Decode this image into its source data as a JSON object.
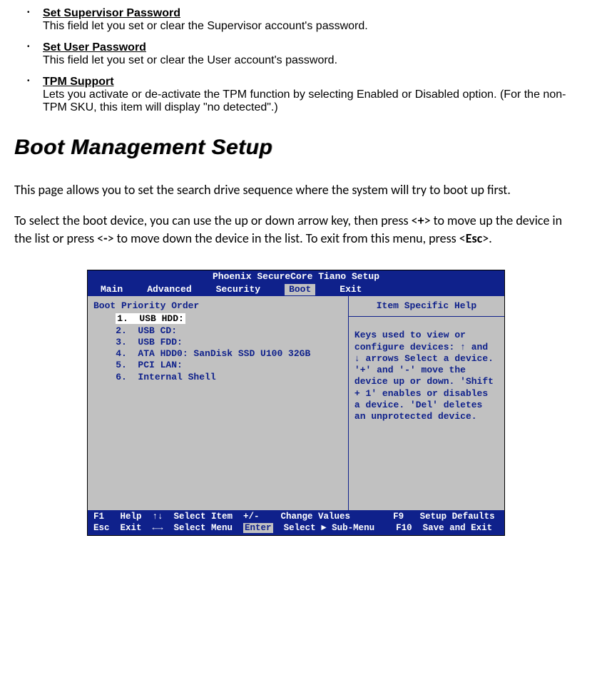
{
  "items": [
    {
      "title": "Set Supervisor Password",
      "desc": "This field let you set or clear the Supervisor account's password."
    },
    {
      "title": "Set User Password",
      "desc": "This field let you set or clear the User account's password."
    },
    {
      "title": "TPM Support",
      "desc": "Lets you activate or de-activate the TPM function by selecting Enabled or Disabled option. (For the non-TPM SKU, this item will display \"no detected\".)"
    }
  ],
  "section_title": "Boot Management Setup",
  "para1": "This page allows you to set the search drive sequence where the system will try to boot up first.",
  "para2a": "To select the boot device, you can use the up or down arrow key, then press <",
  "para2_plus": "+",
  "para2b": "> to move up the device in the list or press <",
  "para2_minus": "-",
  "para2c": "> to move down the device in the list. To exit from this menu, press <",
  "para2_esc": "Esc",
  "para2d": ">.",
  "bios": {
    "title": "Phoenix SecureCore Tiano Setup",
    "menu": [
      "Main",
      "Advanced",
      "Security",
      "Boot",
      "Exit"
    ],
    "active_menu": "Boot",
    "left_header": "Boot Priority Order",
    "boot_rows": [
      "1.  USB HDD:",
      "2.  USB CD:",
      "3.  USB FDD:",
      "4.  ATA HDD0: SanDisk SSD U100 32GB",
      "5.  PCI LAN:",
      "6.  Internal Shell"
    ],
    "help_title": "Item Specific Help",
    "help_body": "Keys used to view or configure devices: ↑ and ↓ arrows Select a device. '+' and '-' move the device up or down. 'Shift + 1' enables or disables a device. 'Del' deletes an unprotected device.",
    "footer1": "F1   Help  ↑↓  Select Item  +/-    Change Values        F9   Setup Defaults",
    "footer2a": "Esc  Exit  ←→  Select Menu  ",
    "footer2_enter": "Enter",
    "footer2b": "  Select ► Sub-Menu    F10  Save and Exit"
  }
}
